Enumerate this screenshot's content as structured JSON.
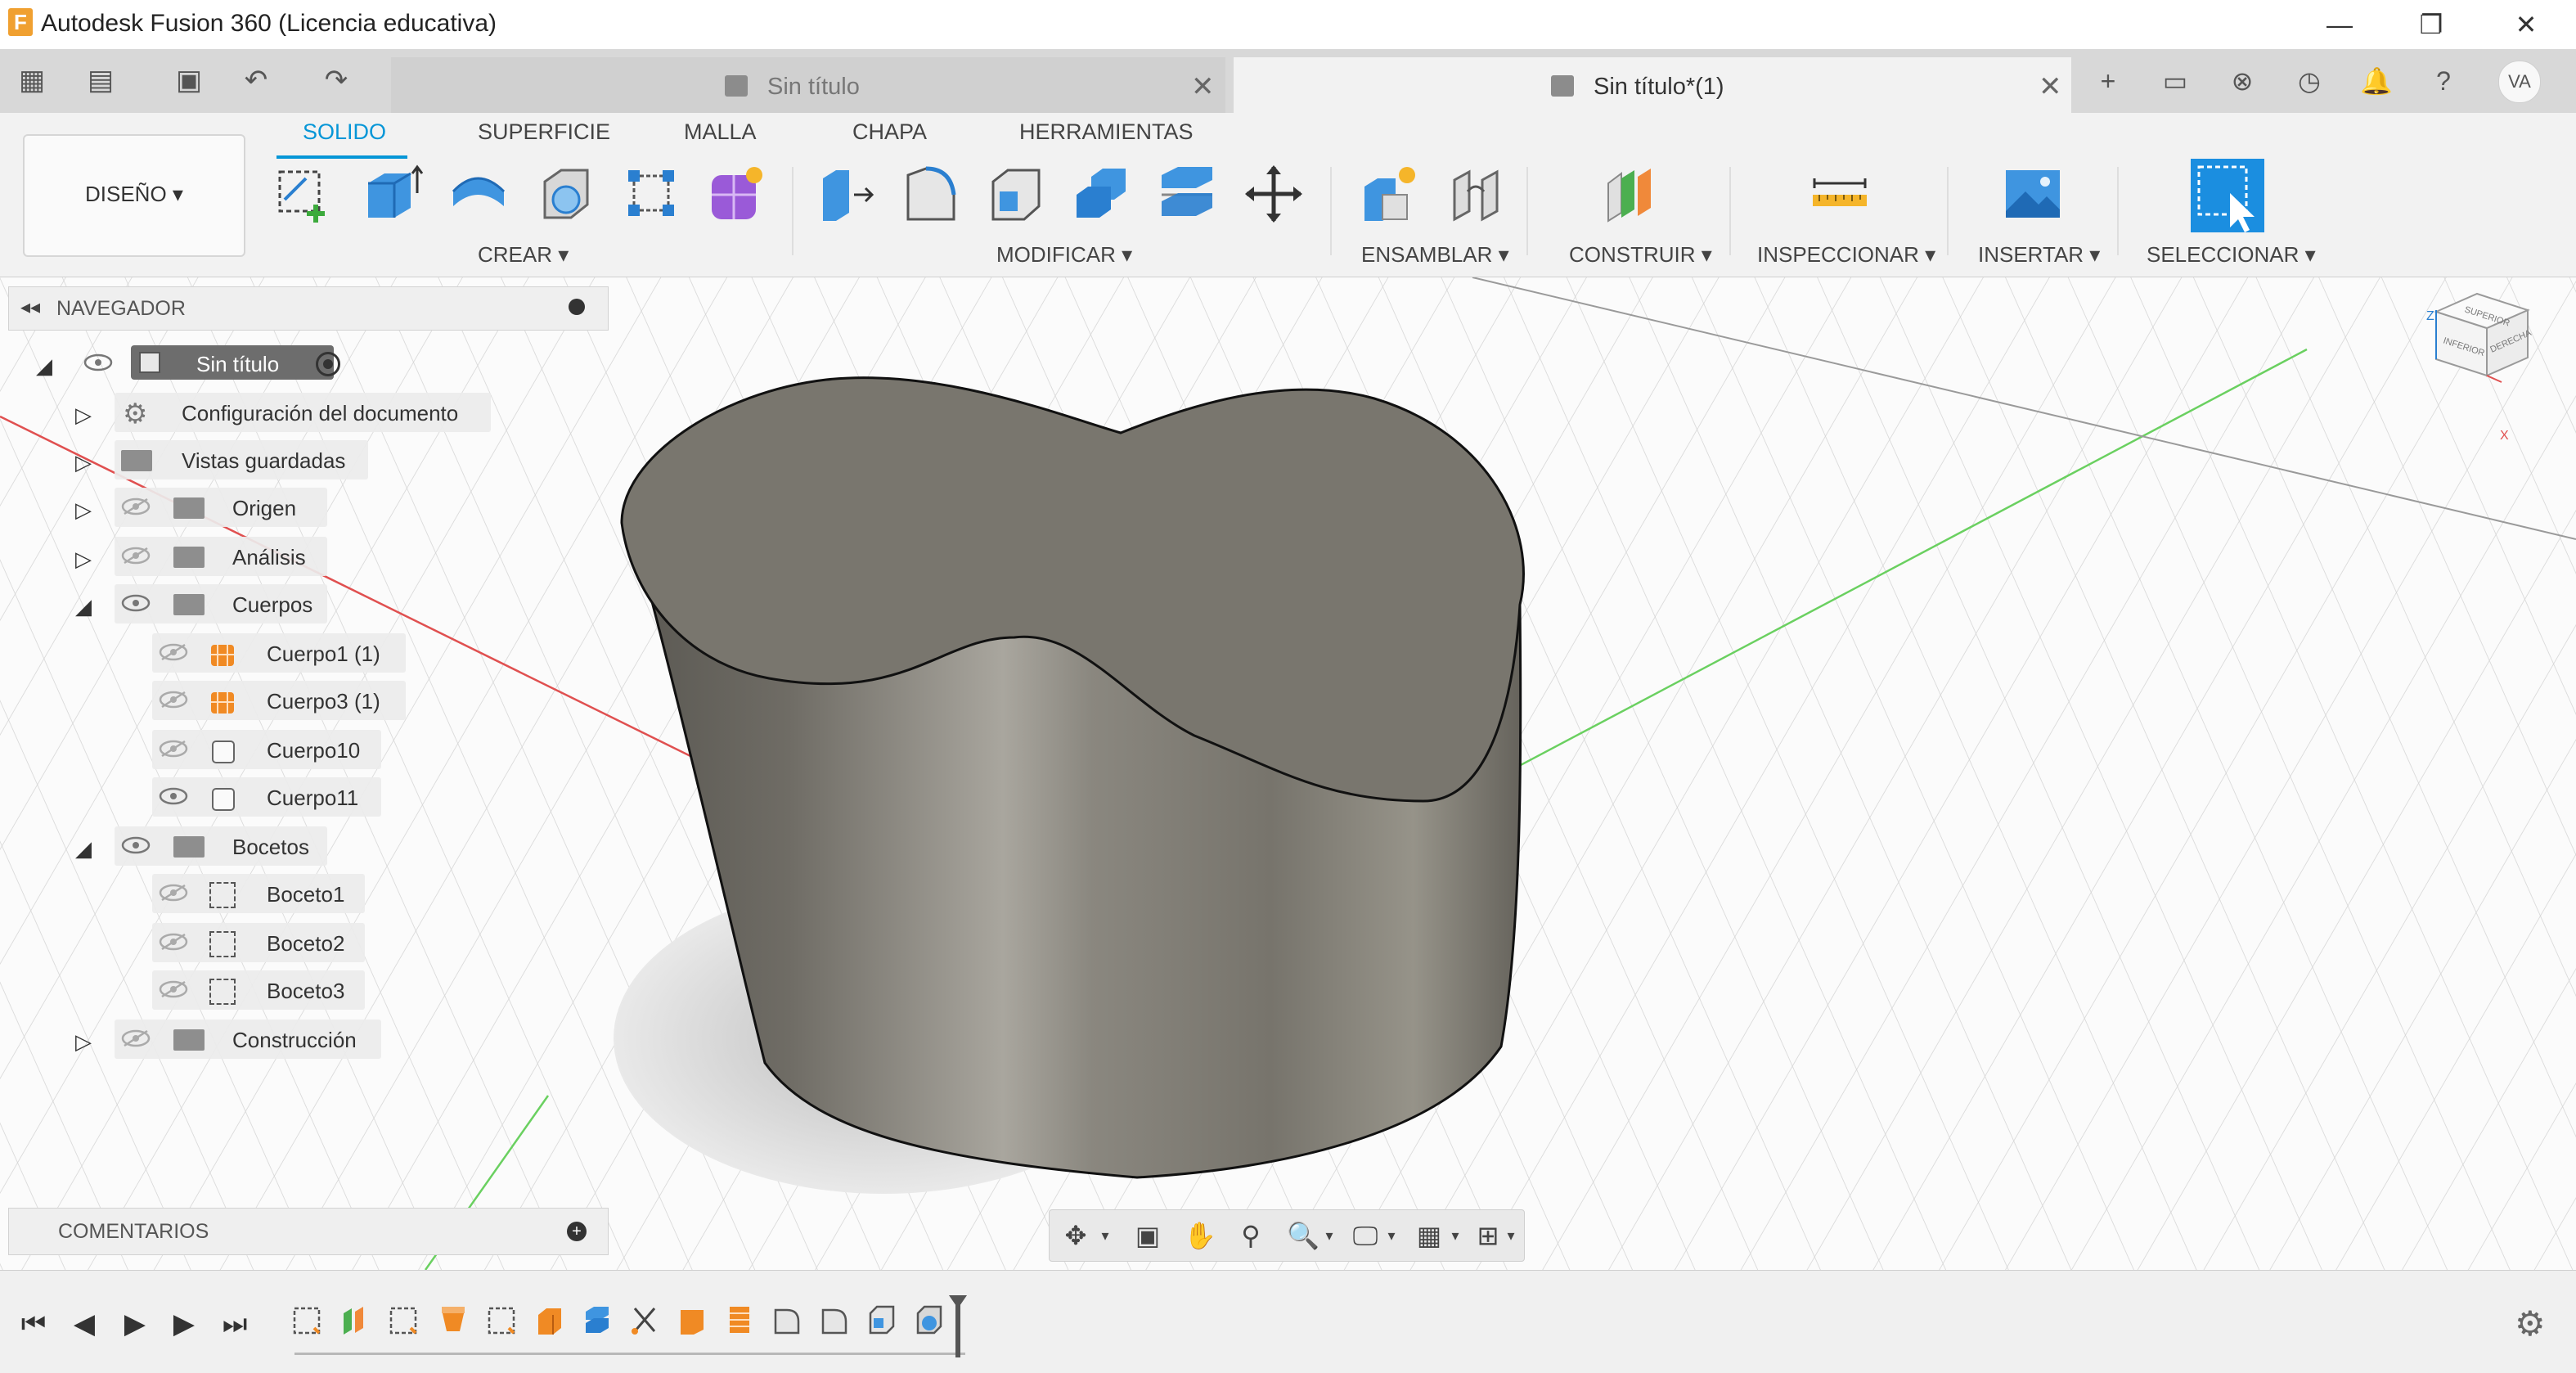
{
  "window": {
    "title": "Autodesk Fusion 360 (Licencia educativa)",
    "logo_letter": "F",
    "controls": {
      "minimize": "—",
      "restore": "❐",
      "close": "✕"
    }
  },
  "tabs": [
    {
      "label": "Sin título",
      "close": "✕",
      "active": false
    },
    {
      "label": "Sin título*(1)",
      "close": "✕",
      "active": true
    }
  ],
  "user": {
    "initials": "VA"
  },
  "toolbar": {
    "workspace_label": "DISEÑO ▾",
    "workspace_tabs": [
      "SOLIDO",
      "SUPERFICIE",
      "MALLA",
      "CHAPA",
      "HERRAMIENTAS"
    ],
    "groups": [
      "CREAR ▾",
      "MODIFICAR ▾",
      "ENSAMBLAR ▾",
      "CONSTRUIR ▾",
      "INSPECCIONAR ▾",
      "INSERTAR ▾",
      "SELECCIONAR ▾"
    ]
  },
  "browser": {
    "title": "NAVEGADOR",
    "nodes": [
      {
        "label": "Sin título"
      },
      {
        "label": "Configuración del documento"
      },
      {
        "label": "Vistas guardadas"
      },
      {
        "label": "Origen"
      },
      {
        "label": "Análisis"
      },
      {
        "label": "Cuerpos"
      },
      {
        "label": "Cuerpo1 (1)"
      },
      {
        "label": "Cuerpo3 (1)"
      },
      {
        "label": "Cuerpo10"
      },
      {
        "label": "Cuerpo11"
      },
      {
        "label": "Bocetos"
      },
      {
        "label": "Boceto1"
      },
      {
        "label": "Boceto2"
      },
      {
        "label": "Boceto3"
      },
      {
        "label": "Construcción"
      }
    ]
  },
  "comments": {
    "title": "COMENTARIOS"
  },
  "viewcube": {
    "axis_z": "Z",
    "axis_x": "X",
    "faces": [
      "SUPERIOR",
      "INFERIOR",
      "DERECHA"
    ]
  },
  "colors": {
    "accent": "#0696d7",
    "body_orange": "#f08a24",
    "model_gray": "#7a776f",
    "axis_red": "#e05050",
    "axis_green": "#6ad060"
  }
}
